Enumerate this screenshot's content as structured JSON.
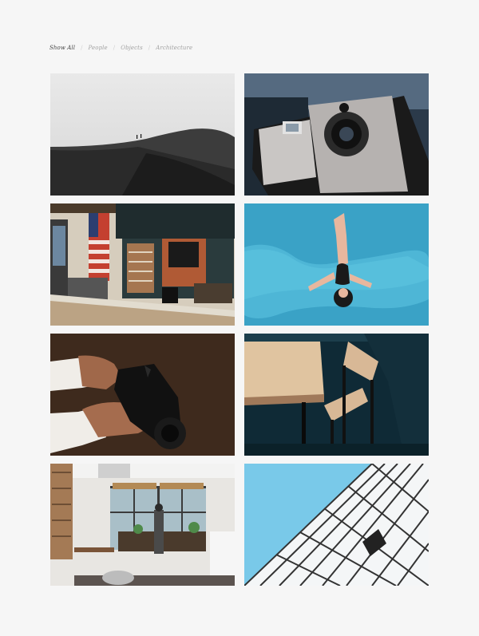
{
  "filters": [
    {
      "label": "Show All",
      "active": true
    },
    {
      "label": "People",
      "active": false
    },
    {
      "label": "Objects",
      "active": false
    },
    {
      "label": "Architecture",
      "active": false
    }
  ],
  "gallery": {
    "items": [
      {
        "subject": "desert-dunes-photo"
      },
      {
        "subject": "polaroid-camera-photo"
      },
      {
        "subject": "coffee-shop-counter-photo"
      },
      {
        "subject": "woman-in-pool-photo"
      },
      {
        "subject": "hands-holding-camera-photo"
      },
      {
        "subject": "wooden-table-chair-photo"
      },
      {
        "subject": "studio-interior-photo"
      },
      {
        "subject": "glass-building-photo"
      }
    ]
  },
  "colors": {
    "background": "#f6f6f6",
    "filter_active": "#444444",
    "filter_inactive": "#a3a3a3"
  }
}
